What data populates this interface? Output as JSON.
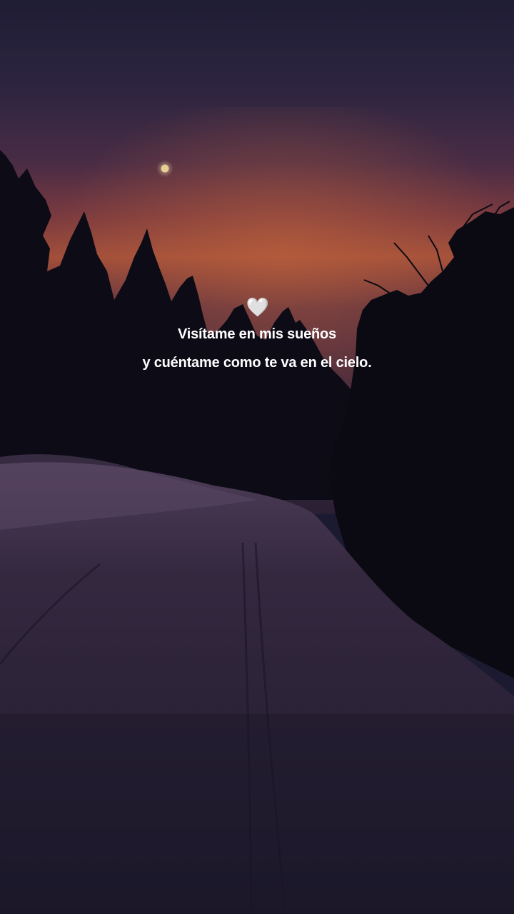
{
  "caption": {
    "heart_glyph": "🤍",
    "line1": "Visítame en mis sueños",
    "line2": "y cuéntame como te va en el cielo."
  },
  "scene": {
    "icon": "heart-icon",
    "colors": {
      "sky_top": "#22203a",
      "sky_mid": "#4a2b47",
      "sky_glow": "#b0583e",
      "trees": "#0b0a14",
      "snow_near": "#2a2336",
      "snow_far": "#4a3a55",
      "moon": "#e6cf94",
      "text": "#ffffff"
    }
  }
}
